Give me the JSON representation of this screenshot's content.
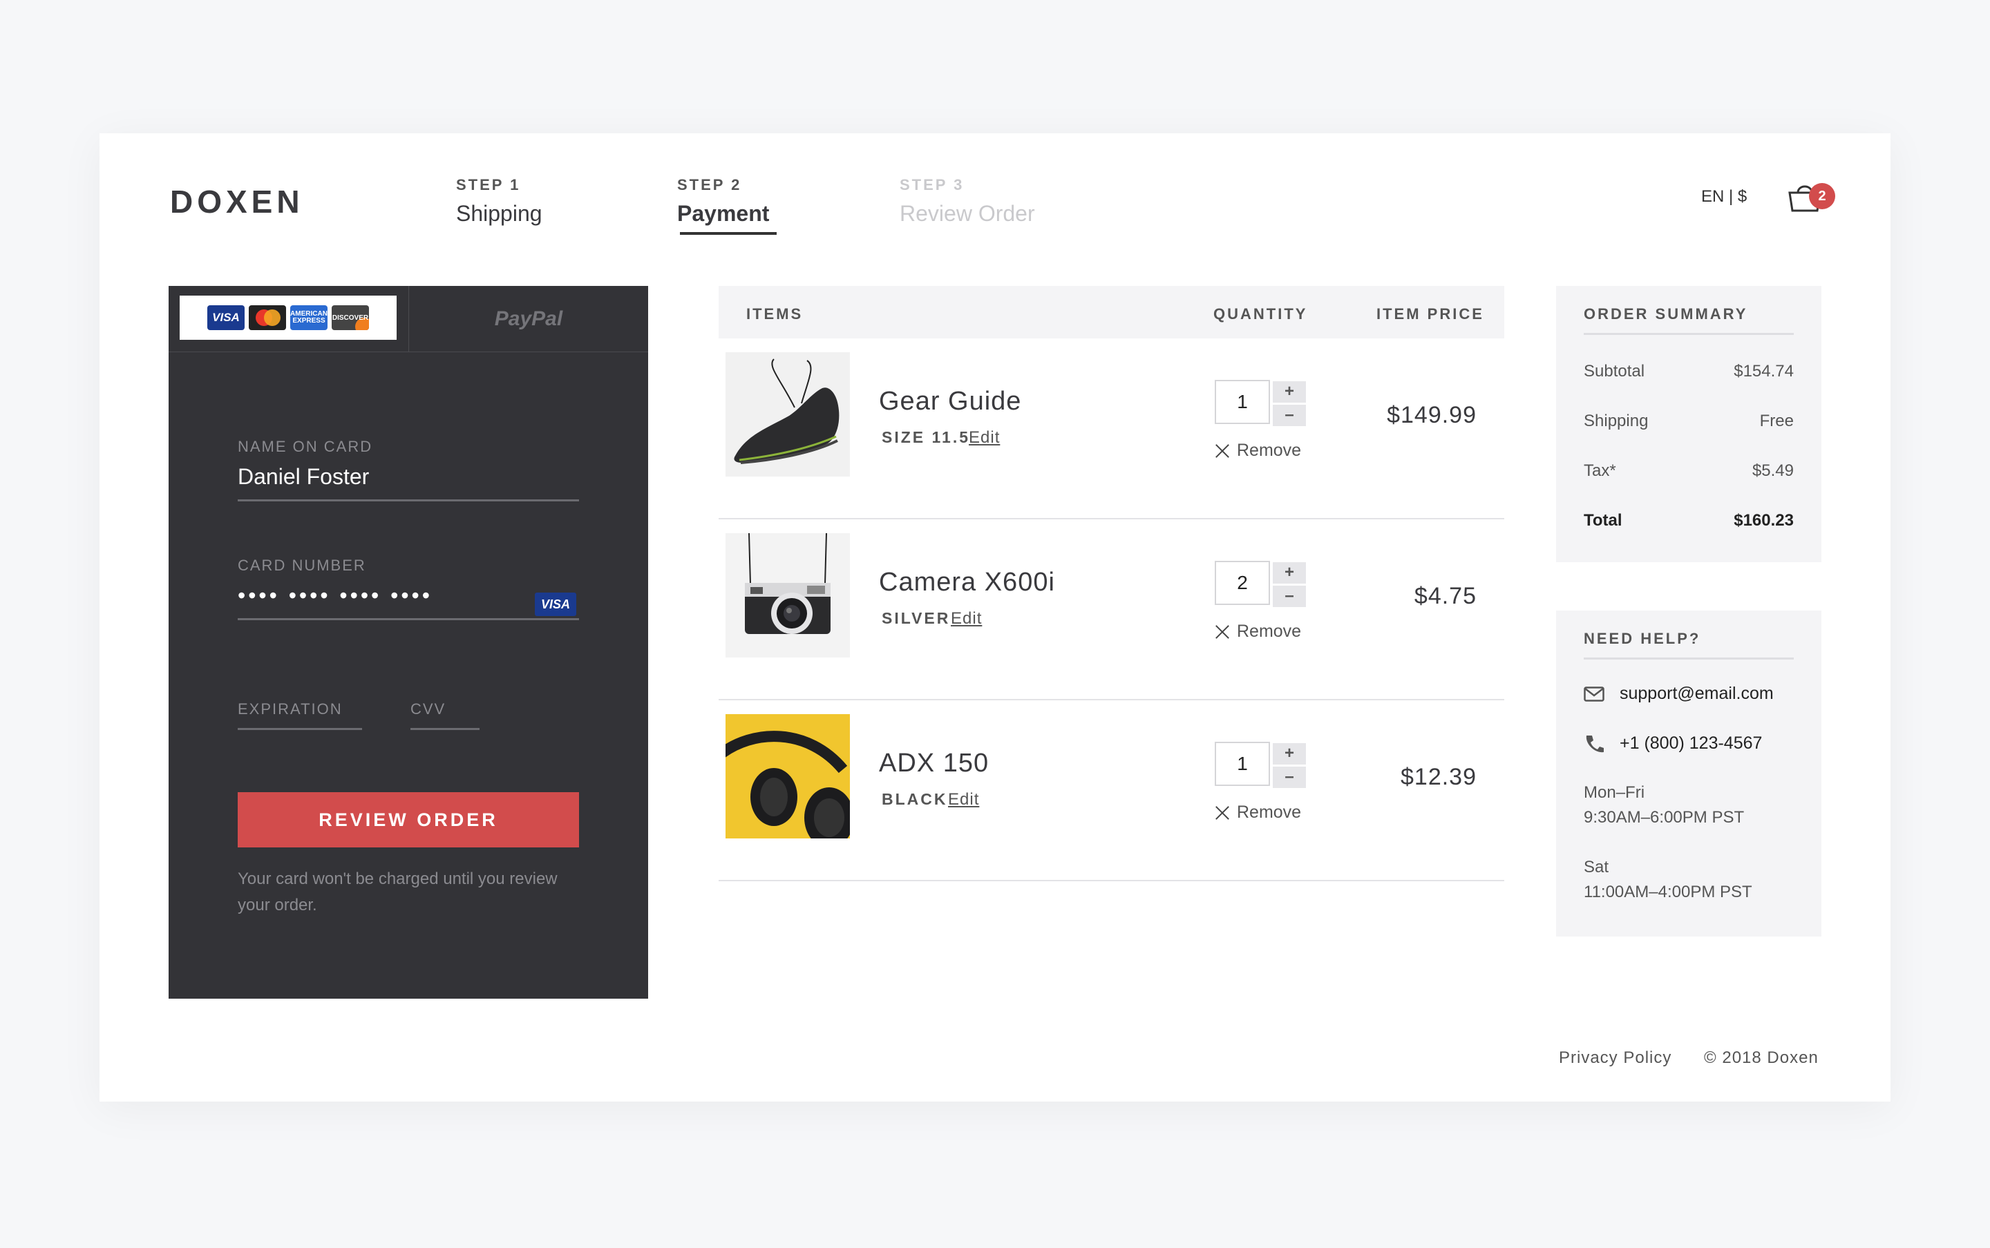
{
  "brand": {
    "logo": "DOXEN"
  },
  "steps": [
    {
      "num": "STEP 1",
      "name": "Shipping",
      "state": "done"
    },
    {
      "num": "STEP 2",
      "name": "Payment",
      "state": "active"
    },
    {
      "num": "STEP 3",
      "name": "Review Order",
      "state": "disabled"
    }
  ],
  "header": {
    "locale": "EN | $",
    "cart_count": "2"
  },
  "payment": {
    "card_logos": [
      "VISA",
      "MasterCard",
      "AMERICAN EXPRESS",
      "DISCOVER"
    ],
    "paypal_label": "PayPal",
    "name_label": "NAME ON CARD",
    "name_value": "Daniel Foster",
    "number_label": "CARD NUMBER",
    "number_value": "•••• •••• •••• ••••",
    "number_brand": "VISA",
    "expiration_label": "EXPIRATION",
    "cvv_label": "CVV",
    "review_button": "REVIEW ORDER",
    "note": "Your card won't be charged until you review your order."
  },
  "items_table": {
    "headers": {
      "items": "ITEMS",
      "quantity": "QUANTITY",
      "price": "ITEM PRICE"
    },
    "remove_label": "Remove",
    "edit_label": "Edit",
    "rows": [
      {
        "name": "Gear Guide",
        "variant": "SIZE 11.5",
        "qty": "1",
        "price": "$149.99",
        "image": "black-sneaker"
      },
      {
        "name": "Camera X600i",
        "variant": "SILVER",
        "qty": "2",
        "price": "$4.75",
        "image": "retro-camera"
      },
      {
        "name": "ADX 150",
        "variant": "BLACK",
        "qty": "1",
        "price": "$12.39",
        "image": "headphones"
      }
    ]
  },
  "summary": {
    "title": "ORDER SUMMARY",
    "subtotal_label": "Subtotal",
    "subtotal": "$154.74",
    "shipping_label": "Shipping",
    "shipping": "Free",
    "tax_label": "Tax*",
    "tax": "$5.49",
    "total_label": "Total",
    "total": "$160.23"
  },
  "help": {
    "title": "NEED HELP?",
    "email": "support@email.com",
    "phone": "+1 (800) 123-4567",
    "weekday_days": "Mon–Fri",
    "weekday_hours": "9:30AM–6:00PM PST",
    "sat_days": "Sat",
    "sat_hours": "11:00AM–4:00PM PST"
  },
  "footer": {
    "privacy": "Privacy Policy",
    "copyright": "© 2018 Doxen"
  },
  "colors": {
    "accent": "#d24c4c",
    "panel": "#333337",
    "visa": "#1a3a8f"
  }
}
